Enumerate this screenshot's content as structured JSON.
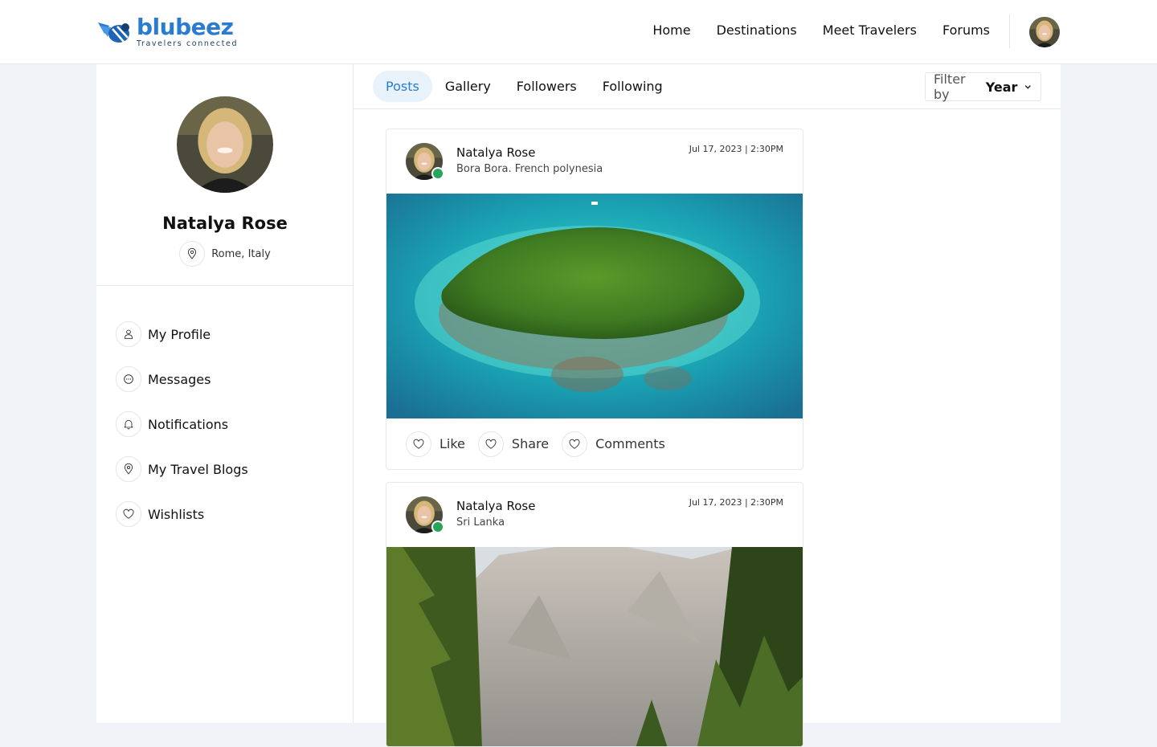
{
  "brand": {
    "name": "blubeez",
    "tagline": "Travelers connected",
    "color": "#2a7bd2"
  },
  "nav": {
    "home": "Home",
    "destinations": "Destinations",
    "meet_travelers": "Meet Travelers",
    "forums": "Forums"
  },
  "profile": {
    "name": "Natalya Rose",
    "location": "Rome, Italy"
  },
  "menu": [
    {
      "label": "My Profile",
      "icon": "user-icon"
    },
    {
      "label": "Messages",
      "icon": "chat-icon"
    },
    {
      "label": "Notifications",
      "icon": "bell-icon"
    },
    {
      "label": "My Travel Blogs",
      "icon": "map-pin-icon"
    },
    {
      "label": "Wishlists",
      "icon": "heart-icon"
    }
  ],
  "tabs": [
    {
      "label": "Posts",
      "active": true
    },
    {
      "label": "Gallery",
      "active": false
    },
    {
      "label": "Followers",
      "active": false
    },
    {
      "label": "Following",
      "active": false
    }
  ],
  "filter": {
    "label": "Filter by",
    "value": "Year"
  },
  "posts": [
    {
      "author": "Natalya Rose",
      "location": "Bora Bora. French polynesia",
      "date": "Jul 17, 2023 | 2:30PM",
      "image": "aerial-island-photo"
    },
    {
      "author": "Natalya Rose",
      "location": "Sri Lanka",
      "date": "Jul 17, 2023 | 2:30PM",
      "image": "mountain-forest-photo"
    }
  ],
  "actions": {
    "like": "Like",
    "share": "Share",
    "comments": "Comments"
  },
  "colors": {
    "accent": "#2a7bd2",
    "active_tab_bg": "#e8f2fb",
    "online": "#27a55a",
    "page_bg": "#f1f3f8"
  }
}
